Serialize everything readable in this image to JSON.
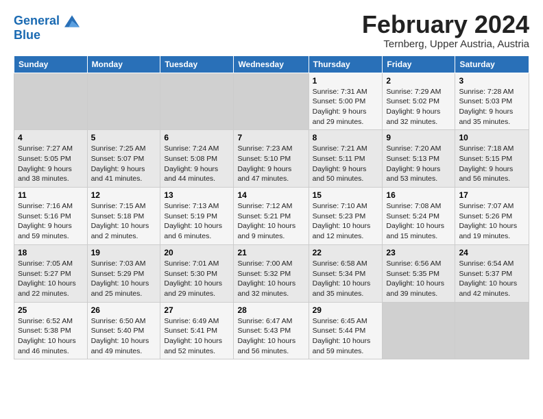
{
  "header": {
    "logo_line1": "General",
    "logo_line2": "Blue",
    "title": "February 2024",
    "subtitle": "Ternberg, Upper Austria, Austria"
  },
  "days_of_week": [
    "Sunday",
    "Monday",
    "Tuesday",
    "Wednesday",
    "Thursday",
    "Friday",
    "Saturday"
  ],
  "weeks": [
    [
      {
        "day": "",
        "info": ""
      },
      {
        "day": "",
        "info": ""
      },
      {
        "day": "",
        "info": ""
      },
      {
        "day": "",
        "info": ""
      },
      {
        "day": "1",
        "info": "Sunrise: 7:31 AM\nSunset: 5:00 PM\nDaylight: 9 hours and 29 minutes."
      },
      {
        "day": "2",
        "info": "Sunrise: 7:29 AM\nSunset: 5:02 PM\nDaylight: 9 hours and 32 minutes."
      },
      {
        "day": "3",
        "info": "Sunrise: 7:28 AM\nSunset: 5:03 PM\nDaylight: 9 hours and 35 minutes."
      }
    ],
    [
      {
        "day": "4",
        "info": "Sunrise: 7:27 AM\nSunset: 5:05 PM\nDaylight: 9 hours and 38 minutes."
      },
      {
        "day": "5",
        "info": "Sunrise: 7:25 AM\nSunset: 5:07 PM\nDaylight: 9 hours and 41 minutes."
      },
      {
        "day": "6",
        "info": "Sunrise: 7:24 AM\nSunset: 5:08 PM\nDaylight: 9 hours and 44 minutes."
      },
      {
        "day": "7",
        "info": "Sunrise: 7:23 AM\nSunset: 5:10 PM\nDaylight: 9 hours and 47 minutes."
      },
      {
        "day": "8",
        "info": "Sunrise: 7:21 AM\nSunset: 5:11 PM\nDaylight: 9 hours and 50 minutes."
      },
      {
        "day": "9",
        "info": "Sunrise: 7:20 AM\nSunset: 5:13 PM\nDaylight: 9 hours and 53 minutes."
      },
      {
        "day": "10",
        "info": "Sunrise: 7:18 AM\nSunset: 5:15 PM\nDaylight: 9 hours and 56 minutes."
      }
    ],
    [
      {
        "day": "11",
        "info": "Sunrise: 7:16 AM\nSunset: 5:16 PM\nDaylight: 9 hours and 59 minutes."
      },
      {
        "day": "12",
        "info": "Sunrise: 7:15 AM\nSunset: 5:18 PM\nDaylight: 10 hours and 2 minutes."
      },
      {
        "day": "13",
        "info": "Sunrise: 7:13 AM\nSunset: 5:19 PM\nDaylight: 10 hours and 6 minutes."
      },
      {
        "day": "14",
        "info": "Sunrise: 7:12 AM\nSunset: 5:21 PM\nDaylight: 10 hours and 9 minutes."
      },
      {
        "day": "15",
        "info": "Sunrise: 7:10 AM\nSunset: 5:23 PM\nDaylight: 10 hours and 12 minutes."
      },
      {
        "day": "16",
        "info": "Sunrise: 7:08 AM\nSunset: 5:24 PM\nDaylight: 10 hours and 15 minutes."
      },
      {
        "day": "17",
        "info": "Sunrise: 7:07 AM\nSunset: 5:26 PM\nDaylight: 10 hours and 19 minutes."
      }
    ],
    [
      {
        "day": "18",
        "info": "Sunrise: 7:05 AM\nSunset: 5:27 PM\nDaylight: 10 hours and 22 minutes."
      },
      {
        "day": "19",
        "info": "Sunrise: 7:03 AM\nSunset: 5:29 PM\nDaylight: 10 hours and 25 minutes."
      },
      {
        "day": "20",
        "info": "Sunrise: 7:01 AM\nSunset: 5:30 PM\nDaylight: 10 hours and 29 minutes."
      },
      {
        "day": "21",
        "info": "Sunrise: 7:00 AM\nSunset: 5:32 PM\nDaylight: 10 hours and 32 minutes."
      },
      {
        "day": "22",
        "info": "Sunrise: 6:58 AM\nSunset: 5:34 PM\nDaylight: 10 hours and 35 minutes."
      },
      {
        "day": "23",
        "info": "Sunrise: 6:56 AM\nSunset: 5:35 PM\nDaylight: 10 hours and 39 minutes."
      },
      {
        "day": "24",
        "info": "Sunrise: 6:54 AM\nSunset: 5:37 PM\nDaylight: 10 hours and 42 minutes."
      }
    ],
    [
      {
        "day": "25",
        "info": "Sunrise: 6:52 AM\nSunset: 5:38 PM\nDaylight: 10 hours and 46 minutes."
      },
      {
        "day": "26",
        "info": "Sunrise: 6:50 AM\nSunset: 5:40 PM\nDaylight: 10 hours and 49 minutes."
      },
      {
        "day": "27",
        "info": "Sunrise: 6:49 AM\nSunset: 5:41 PM\nDaylight: 10 hours and 52 minutes."
      },
      {
        "day": "28",
        "info": "Sunrise: 6:47 AM\nSunset: 5:43 PM\nDaylight: 10 hours and 56 minutes."
      },
      {
        "day": "29",
        "info": "Sunrise: 6:45 AM\nSunset: 5:44 PM\nDaylight: 10 hours and 59 minutes."
      },
      {
        "day": "",
        "info": ""
      },
      {
        "day": "",
        "info": ""
      }
    ]
  ]
}
